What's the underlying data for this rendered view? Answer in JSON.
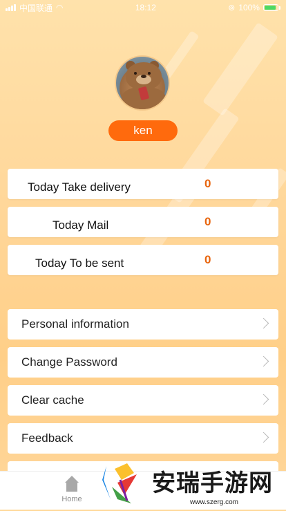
{
  "status_bar": {
    "carrier": "中国联通",
    "time": "18:12",
    "battery": "100%"
  },
  "profile": {
    "username": "ken"
  },
  "stats": [
    {
      "label": "Today Take delivery",
      "value": "0"
    },
    {
      "label": "Today Mail",
      "value": "0"
    },
    {
      "label": "Today To be sent",
      "value": "0"
    }
  ],
  "menu": [
    {
      "label": "Personal information"
    },
    {
      "label": "Change Password"
    },
    {
      "label": "Clear cache"
    },
    {
      "label": "Feedback"
    }
  ],
  "tabbar": {
    "home_label": "Home"
  },
  "watermark": {
    "text": "安瑞手游网",
    "url": "www.szerg.com"
  },
  "colors": {
    "accent": "#ff6a0d",
    "stat_value": "#e8640c",
    "background": "#ffd99a"
  }
}
